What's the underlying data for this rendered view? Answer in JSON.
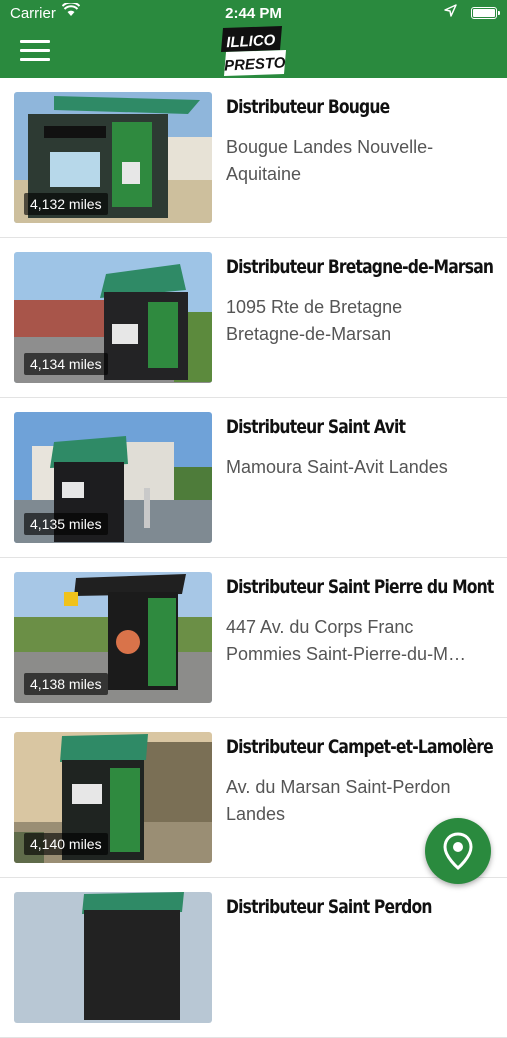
{
  "status_bar": {
    "carrier": "Carrier",
    "time": "2:44 PM"
  },
  "header": {
    "logo_line1": "ILLICO",
    "logo_line2": "PRESTO"
  },
  "colors": {
    "brand_green": "#2a8a3e"
  },
  "locations": [
    {
      "title": "Distributeur Bougue",
      "address_line1": "Bougue Landes Nouvelle-",
      "address_line2": "Aquitaine",
      "distance": "4,132 miles"
    },
    {
      "title": "Distributeur  Bretagne-de-Marsan",
      "address_line1": "1095 Rte de Bretagne",
      "address_line2": "Bretagne-de-Marsan",
      "distance": "4,134 miles"
    },
    {
      "title": "Distributeur Saint Avit",
      "address_line1": "Mamoura Saint-Avit Landes",
      "address_line2": "",
      "distance": "4,135 miles"
    },
    {
      "title": "Distributeur Saint Pierre du Mont",
      "address_line1": "447 Av. du Corps Franc",
      "address_line2": "Pommies Saint-Pierre-du-M…",
      "distance": "4,138 miles"
    },
    {
      "title": "Distributeur Campet-et-Lamolère",
      "address_line1": "Av. du Marsan Saint-Perdon",
      "address_line2": "Landes",
      "distance": "4,140 miles"
    },
    {
      "title": "Distributeur Saint Perdon",
      "address_line1": "",
      "address_line2": "",
      "distance": ""
    }
  ],
  "icons": {
    "menu": "hamburger-menu-icon",
    "map": "map-pin-icon"
  }
}
